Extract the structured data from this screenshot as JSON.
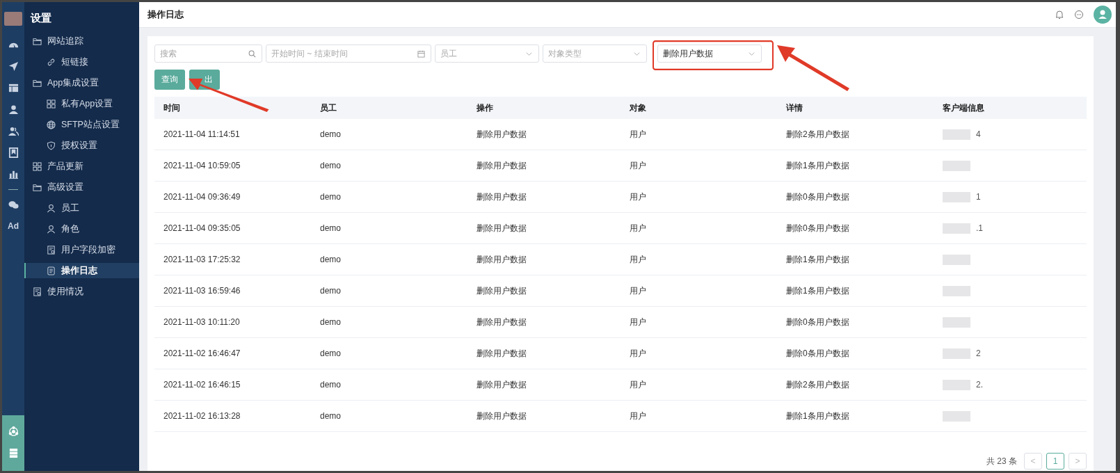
{
  "header": {
    "title": "操作日志"
  },
  "rail": {
    "label": "Ad"
  },
  "sidebar": {
    "title": "设置",
    "items": [
      {
        "label": "网站追踪",
        "selected": false,
        "children": [
          {
            "label": "短链接",
            "selected": false
          }
        ]
      },
      {
        "label": "App集成设置",
        "selected": false,
        "children": [
          {
            "label": "私有App设置",
            "selected": false
          },
          {
            "label": "SFTP站点设置",
            "selected": false
          },
          {
            "label": "授权设置",
            "selected": false
          }
        ]
      },
      {
        "label": "产品更新",
        "selected": false
      },
      {
        "label": "高级设置",
        "selected": false,
        "children": [
          {
            "label": "员工",
            "selected": false
          },
          {
            "label": "角色",
            "selected": false
          },
          {
            "label": "用户字段加密",
            "selected": false
          },
          {
            "label": "操作日志",
            "selected": true
          }
        ]
      },
      {
        "label": "使用情况",
        "selected": false
      }
    ]
  },
  "filters": [
    {
      "kind": "search",
      "placeholder": "搜索"
    },
    {
      "kind": "daterange",
      "placeholder": "开始时间 ~ 结束时间"
    },
    {
      "kind": "select",
      "placeholder": "员工"
    },
    {
      "kind": "select",
      "placeholder": "对象类型"
    },
    {
      "kind": "select",
      "value": "删除用户数据"
    }
  ],
  "buttons": [
    "查询",
    "出"
  ],
  "table": {
    "columns": [
      "时间",
      "员工",
      "操作",
      "对象",
      "详情",
      "客户端信息"
    ],
    "rows": [
      {
        "time": "2021-11-04 11:14:51",
        "staff": "demo",
        "action": "删除用户数据",
        "object": "用户",
        "detail": "删除2条用户数据",
        "client": "4"
      },
      {
        "time": "2021-11-04 10:59:05",
        "staff": "demo",
        "action": "删除用户数据",
        "object": "用户",
        "detail": "删除1条用户数据"
      },
      {
        "time": "2021-11-04 09:36:49",
        "staff": "demo",
        "action": "删除用户数据",
        "object": "用户",
        "detail": "删除0条用户数据",
        "client": "1"
      },
      {
        "time": "2021-11-04 09:35:05",
        "staff": "demo",
        "action": "删除用户数据",
        "object": "用户",
        "detail": "删除0条用户数据",
        "client": ".1"
      },
      {
        "time": "2021-11-03 17:25:32",
        "staff": "demo",
        "action": "删除用户数据",
        "object": "用户",
        "detail": "删除1条用户数据"
      },
      {
        "time": "2021-11-03 16:59:46",
        "staff": "demo",
        "action": "删除用户数据",
        "object": "用户",
        "detail": "删除1条用户数据"
      },
      {
        "time": "2021-11-03 10:11:20",
        "staff": "demo",
        "action": "删除用户数据",
        "object": "用户",
        "detail": "删除0条用户数据"
      },
      {
        "time": "2021-11-02 16:46:47",
        "staff": "demo",
        "action": "删除用户数据",
        "object": "用户",
        "detail": "删除0条用户数据",
        "client": "2"
      },
      {
        "time": "2021-11-02 16:46:15",
        "staff": "demo",
        "action": "删除用户数据",
        "object": "用户",
        "detail": "删除2条用户数据",
        "client": "2."
      },
      {
        "time": "2021-11-02 16:13:28",
        "staff": "demo",
        "action": "删除用户数据",
        "object": "用户",
        "detail": "删除1条用户数据"
      }
    ]
  },
  "pagination": {
    "total": "共 23 条",
    "prev": "<",
    "next": ">",
    "pages": [
      {
        "label": "1",
        "selected": true
      }
    ]
  }
}
